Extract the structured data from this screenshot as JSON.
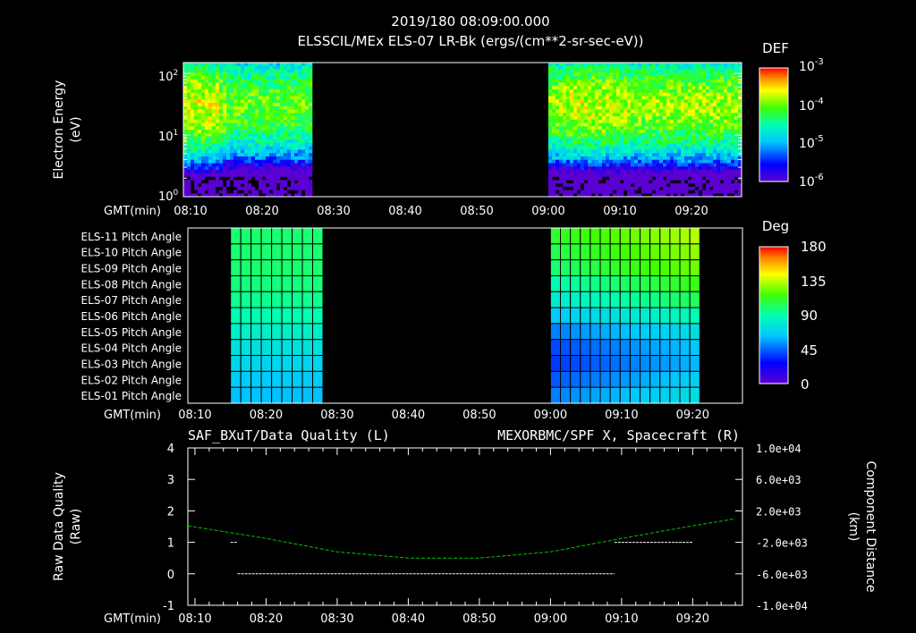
{
  "header": {
    "timestamp": "2019/180  08:09:00.000",
    "subtitle": "ELSSCIL/MEx ELS-07 LR-Bk  (ergs/(cm**2-sr-sec-eV))"
  },
  "time_axis": {
    "label": "GMT(min)",
    "ticks": [
      "08:10",
      "08:20",
      "08:30",
      "08:40",
      "08:50",
      "09:00",
      "09:10",
      "09:20"
    ]
  },
  "energy_panel": {
    "ylabel_line1": "Electron Energy",
    "ylabel_line2": "(eV)",
    "ytick_base": [
      "10",
      "10",
      "10"
    ],
    "ytick_exp": [
      "0",
      "1",
      "2"
    ],
    "colorbar_title": "DEF",
    "colorbar_base": [
      "10",
      "10",
      "10",
      "10"
    ],
    "colorbar_exp": [
      "-3",
      "-4",
      "-5",
      "-6"
    ]
  },
  "pitch_panel": {
    "row_labels": [
      "ELS-11 Pitch Angle",
      "ELS-10 Pitch Angle",
      "ELS-09 Pitch Angle",
      "ELS-08 Pitch Angle",
      "ELS-07 Pitch Angle",
      "ELS-06 Pitch Angle",
      "ELS-05 Pitch Angle",
      "ELS-04 Pitch Angle",
      "ELS-03 Pitch Angle",
      "ELS-02 Pitch Angle",
      "ELS-01 Pitch Angle"
    ],
    "colorbar_title": "Deg",
    "colorbar_ticks": [
      "180",
      "135",
      "90",
      "45",
      "0"
    ]
  },
  "quality_panel": {
    "left_title": "SAF_BXuT/Data Quality (L)",
    "right_title": "MEXORBMC/SPF X, Spacecraft (R)",
    "right_title_color": "#00c800",
    "left_ylabel_line1": "Raw Data Quality",
    "left_ylabel_line2": "(Raw)",
    "left_ticks": [
      "4",
      "3",
      "2",
      "1",
      "0",
      "-1"
    ],
    "right_ylabel_line1": "Component Distance",
    "right_ylabel_line2": "(km)",
    "right_ticks": [
      "1.0e+04",
      "6.0e+03",
      "2.0e+03",
      "-2.0e+03",
      "-6.0e+03",
      "-1.0e+04"
    ]
  },
  "chart_data": [
    {
      "type": "heatmap",
      "xlabel": "GMT(min)",
      "ylabel": "Electron Energy (eV)",
      "yscale": "log",
      "ylim": [
        1,
        150
      ],
      "xlim": [
        "08:09",
        "09:27"
      ],
      "data_gap": [
        "08:27",
        "09:00"
      ],
      "colorbar": {
        "label": "DEF",
        "scale": "log",
        "range": [
          1e-06,
          0.001
        ]
      },
      "description_peaks": {
        "energy_eV": 30,
        "level_before_gap": 0.0001,
        "level_after_gap": 0.0001
      }
    },
    {
      "type": "heatmap",
      "xlabel": "GMT(min)",
      "rows": [
        "ELS-11",
        "ELS-10",
        "ELS-09",
        "ELS-08",
        "ELS-07",
        "ELS-06",
        "ELS-05",
        "ELS-04",
        "ELS-03",
        "ELS-02",
        "ELS-01"
      ],
      "segments": [
        {
          "start": "08:15",
          "end": "08:28",
          "pitch_deg_by_row": [
            100,
            100,
            100,
            98,
            95,
            90,
            82,
            75,
            70,
            65,
            62
          ]
        },
        {
          "start": "09:00",
          "end": "09:21",
          "pitch_deg_by_row": [
            115,
            110,
            105,
            95,
            85,
            70,
            55,
            45,
            42,
            48,
            55
          ]
        }
      ],
      "colorbar": {
        "label": "Deg",
        "range": [
          0,
          180
        ]
      }
    },
    {
      "type": "line",
      "xlabel": "GMT(min)",
      "xlim": [
        "08:09",
        "09:27"
      ],
      "series": [
        {
          "name": "SAF_BXuT/Data Quality",
          "axis": "left",
          "color": "#ffffff",
          "segments": [
            {
              "x": [
                "08:15",
                "08:16"
              ],
              "y": [
                1,
                1
              ]
            },
            {
              "x": [
                "08:16",
                "09:09"
              ],
              "y": [
                0,
                0
              ]
            },
            {
              "x": [
                "09:09",
                "09:20"
              ],
              "y": [
                1,
                1
              ]
            }
          ]
        },
        {
          "name": "MEXORBMC/SPF X, Spacecraft",
          "axis": "right",
          "color": "#00c800",
          "x": [
            "08:09",
            "08:20",
            "08:30",
            "08:40",
            "08:50",
            "09:00",
            "09:10",
            "09:20",
            "09:26"
          ],
          "y": [
            100,
            -1500,
            -3200,
            -4000,
            -4000,
            -3200,
            -1500,
            100,
            1000
          ]
        }
      ],
      "ylim_left": [
        -1,
        4
      ],
      "ylim_right": [
        -10000,
        10000
      ]
    }
  ]
}
